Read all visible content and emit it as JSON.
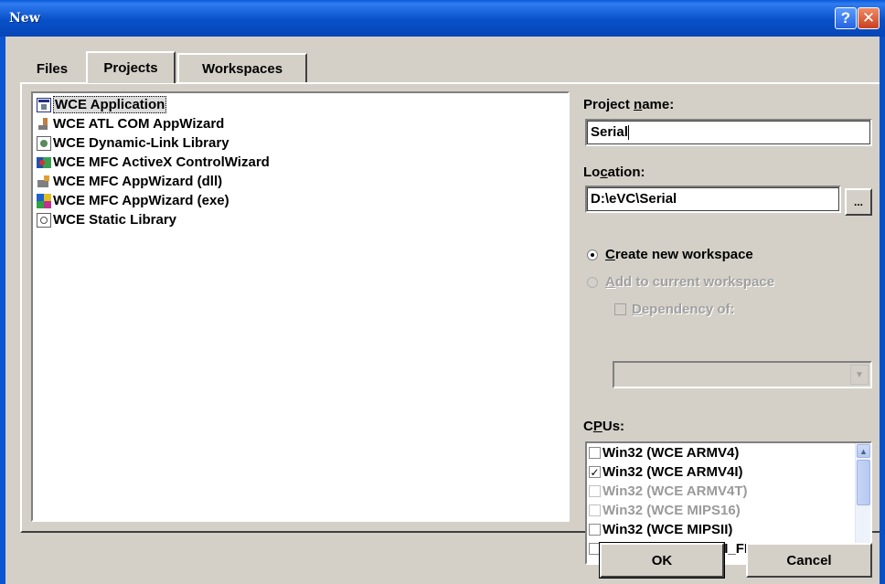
{
  "window": {
    "title": "New",
    "help_glyph": "?",
    "close_glyph": "✕"
  },
  "tabs": [
    {
      "label": "Files",
      "active": false
    },
    {
      "label": "Projects",
      "active": true
    },
    {
      "label": "Workspaces",
      "active": false
    }
  ],
  "projects": [
    {
      "label": "WCE Application",
      "icon": "wce-application-icon",
      "selected": true
    },
    {
      "label": "WCE ATL COM AppWizard",
      "icon": "atl-com-appwizard-icon",
      "selected": false
    },
    {
      "label": "WCE Dynamic-Link Library",
      "icon": "dynamic-link-library-icon",
      "selected": false
    },
    {
      "label": "WCE MFC ActiveX ControlWizard",
      "icon": "activex-controlwizard-icon",
      "selected": false
    },
    {
      "label": "WCE MFC AppWizard (dll)",
      "icon": "mfc-appwizard-dll-icon",
      "selected": false
    },
    {
      "label": "WCE MFC AppWizard (exe)",
      "icon": "mfc-appwizard-exe-icon",
      "selected": false
    },
    {
      "label": "WCE Static Library",
      "icon": "static-library-icon",
      "selected": false
    }
  ],
  "project_name": {
    "label_pre": "Project ",
    "label_key": "n",
    "label_post": "ame:",
    "value": "Serial"
  },
  "location": {
    "label_pre": "Lo",
    "label_key": "c",
    "label_post": "ation:",
    "value": "D:\\eVC\\Serial",
    "browse_label": "..."
  },
  "workspace_options": {
    "create": {
      "key": "C",
      "rest": "reate new workspace",
      "checked": true,
      "enabled": true
    },
    "add": {
      "key": "A",
      "rest": "dd to current workspace",
      "checked": false,
      "enabled": false
    },
    "dependency": {
      "key": "D",
      "rest": "ependency of:",
      "checked": false,
      "enabled": false
    },
    "dependency_value": ""
  },
  "cpus": {
    "label_pre": "C",
    "label_key": "P",
    "label_post": "Us:",
    "items": [
      {
        "label": "Win32 (WCE ARMV4)",
        "checked": false,
        "enabled": true
      },
      {
        "label": "Win32 (WCE ARMV4I)",
        "checked": true,
        "enabled": true
      },
      {
        "label": "Win32 (WCE ARMV4T)",
        "checked": false,
        "enabled": false
      },
      {
        "label": "Win32 (WCE MIPS16)",
        "checked": false,
        "enabled": false
      },
      {
        "label": "Win32 (WCE MIPSII)",
        "checked": false,
        "enabled": true
      },
      {
        "label": "Win32 (WCE MIPSII_FP)",
        "checked": false,
        "enabled": true
      }
    ]
  },
  "buttons": {
    "ok": "OK",
    "cancel": "Cancel"
  },
  "colors": {
    "titlebar": "#0850c8",
    "dialog": "#d4d0c8",
    "close": "#c9401f",
    "disabled_text": "#a0a0a0"
  }
}
